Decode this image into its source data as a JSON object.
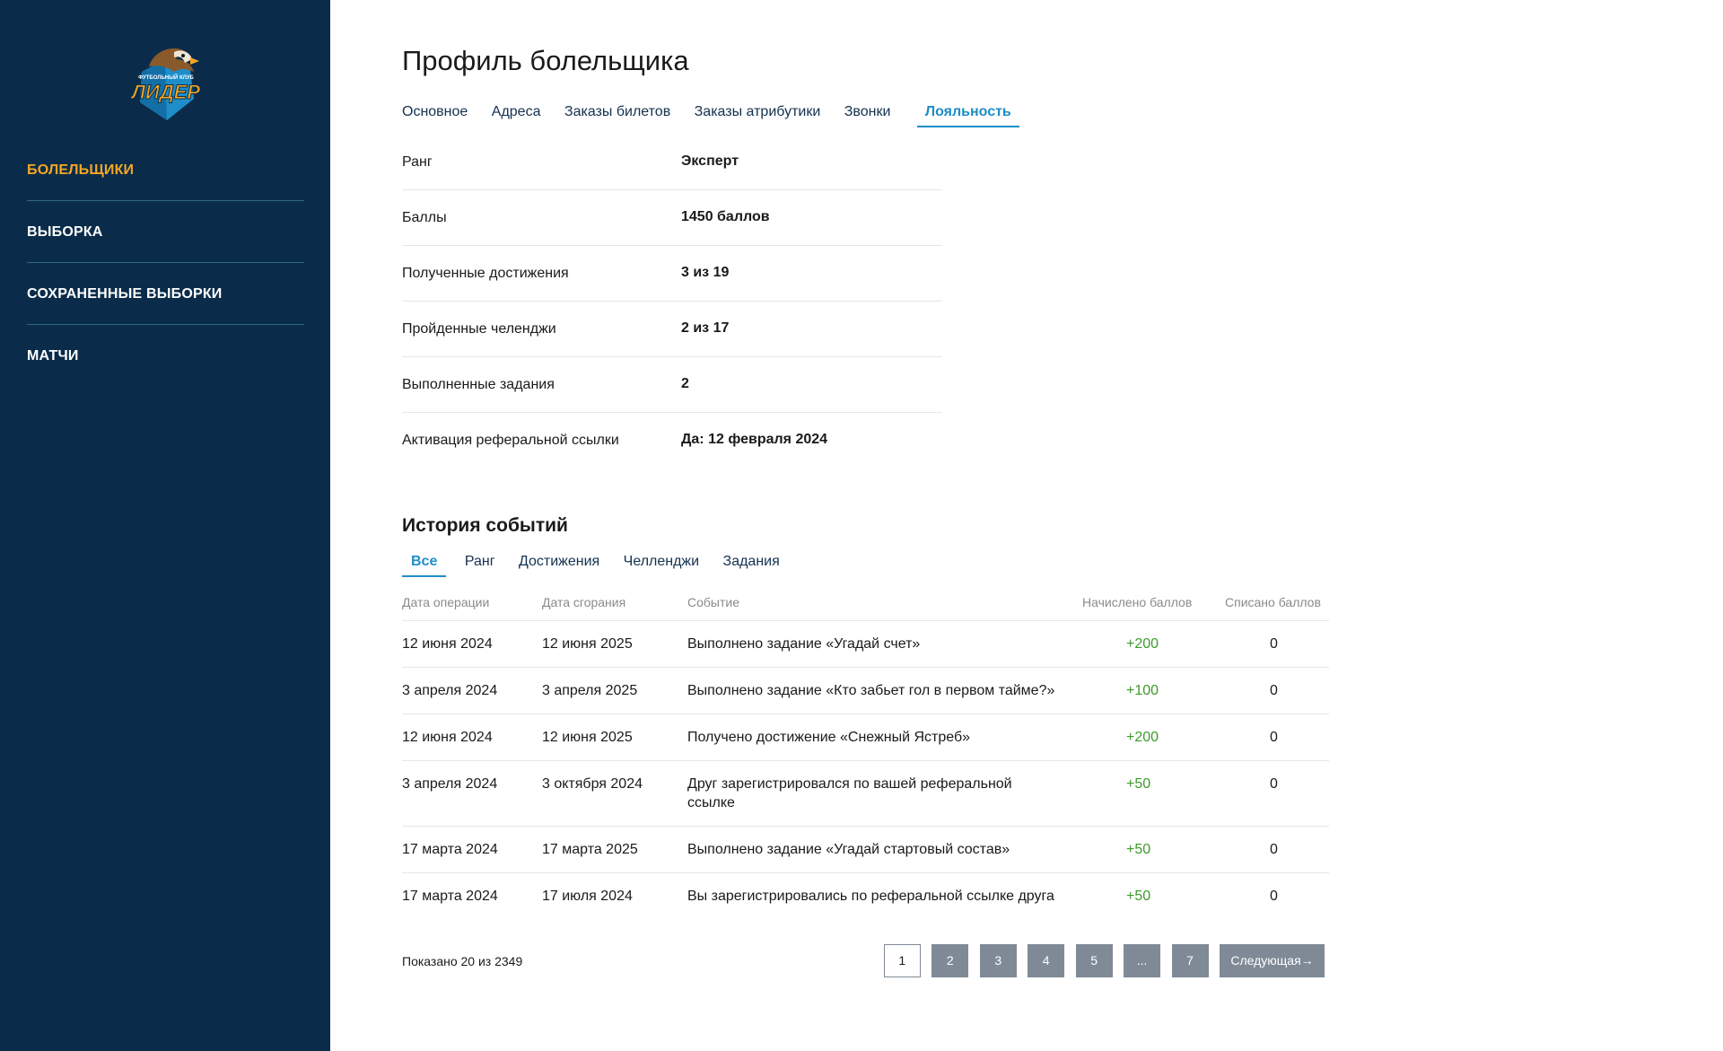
{
  "sidebar": {
    "logo": {
      "text_small": "ФУТБОЛЬНЫЙ КЛУБ",
      "text_big": "ЛИДЕР",
      "colors": {
        "shield": "#1e8ec9",
        "text": "#f5a623"
      }
    },
    "items": [
      {
        "label": "БОЛЕЛЬЩИКИ",
        "active": true
      },
      {
        "label": "ВЫБОРКА",
        "active": false
      },
      {
        "label": "СОХРАНЕННЫЕ ВЫБОРКИ",
        "active": false
      },
      {
        "label": "МАТЧИ",
        "active": false
      }
    ]
  },
  "page": {
    "title": "Профиль болельщика",
    "tabs": [
      {
        "label": "Основное"
      },
      {
        "label": "Адреса"
      },
      {
        "label": "Заказы билетов"
      },
      {
        "label": "Заказы атрибутики"
      },
      {
        "label": "Звонки"
      },
      {
        "label": "Лояльность",
        "active": true
      }
    ]
  },
  "loyalty": [
    {
      "label": "Ранг",
      "value": "Эксперт"
    },
    {
      "label": "Баллы",
      "value": "1450 баллов"
    },
    {
      "label": "Полученные достижения",
      "value": "3 из 19"
    },
    {
      "label": "Пройденные челенджи",
      "value": "2 из 17"
    },
    {
      "label": "Выполненные задания",
      "value": "2"
    },
    {
      "label": "Активация реферальной ссылки",
      "value": "Да: 12 февраля 2024"
    }
  ],
  "history": {
    "title": "История событий",
    "tabs": [
      {
        "label": "Все",
        "active": true
      },
      {
        "label": "Ранг"
      },
      {
        "label": "Достижения"
      },
      {
        "label": "Челленджи"
      },
      {
        "label": "Задания"
      }
    ],
    "columns": {
      "op_date": "Дата операции",
      "burn_date": "Дата сгорания",
      "event": "Событие",
      "credited": "Начислено баллов",
      "debited": "Списано баллов"
    },
    "rows": [
      {
        "op_date": "12 июня 2024",
        "burn_date": "12 июня 2025",
        "event": "Выполнено задание «Угадай счет»",
        "credited": "+200",
        "debited": "0"
      },
      {
        "op_date": "3 апреля 2024",
        "burn_date": "3 апреля 2025",
        "event": "Выполнено задание «Кто забьет гол в первом тайме?»",
        "credited": "+100",
        "debited": "0"
      },
      {
        "op_date": "12 июня 2024",
        "burn_date": "12 июня 2025",
        "event": "Получено достижение «Снежный Ястреб»",
        "credited": "+200",
        "debited": "0"
      },
      {
        "op_date": "3 апреля 2024",
        "burn_date": "3 октября 2024",
        "event": "Друг зарегистрировался по вашей реферальной ссылке",
        "credited": "+50",
        "debited": "0"
      },
      {
        "op_date": "17 марта 2024",
        "burn_date": "17 марта 2025",
        "event": "Выполнено задание «Угадай стартовый состав»",
        "credited": "+50",
        "debited": "0"
      },
      {
        "op_date": "17 марта 2024",
        "burn_date": "17 июля 2024",
        "event": "Вы зарегистрировались по реферальной ссылке друга",
        "credited": "+50",
        "debited": "0"
      }
    ],
    "shown_text": "Показано 20 из 2349",
    "pagination": {
      "pages": [
        "1",
        "2",
        "3",
        "4",
        "5",
        "...",
        "7"
      ],
      "current": "1",
      "next_label": "Следующая→"
    }
  }
}
